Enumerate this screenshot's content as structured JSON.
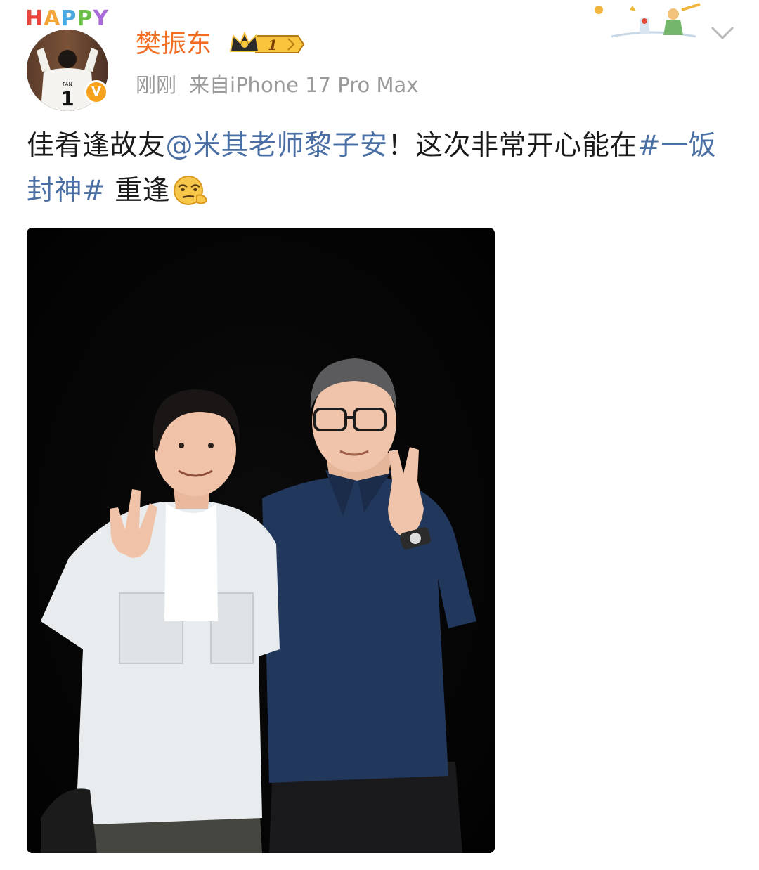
{
  "header": {
    "avatar_caption": "HAPPY",
    "jersey_name": "FAN",
    "jersey_number": "1",
    "verified_mark": "V",
    "username": "樊振东",
    "vip_level": "1",
    "time": "刚刚",
    "source": "来自iPhone 17 Pro Max"
  },
  "post": {
    "text_before_mention": "佳肴逢故友",
    "mention": "@米其老师黎子安",
    "text_middle": "！这次非常开心能在",
    "hashtag": "#一饭封神#",
    "text_after": " 重逢",
    "emoji": "smirk-emoji"
  },
  "colors": {
    "username": "#f26d22",
    "link": "#4a6fa5",
    "meta": "#9a9a9a",
    "text": "#1a1a1a",
    "photo_background": "#050505"
  },
  "icons": {
    "more": "chevron-down-icon",
    "vip": "crown-icon"
  }
}
